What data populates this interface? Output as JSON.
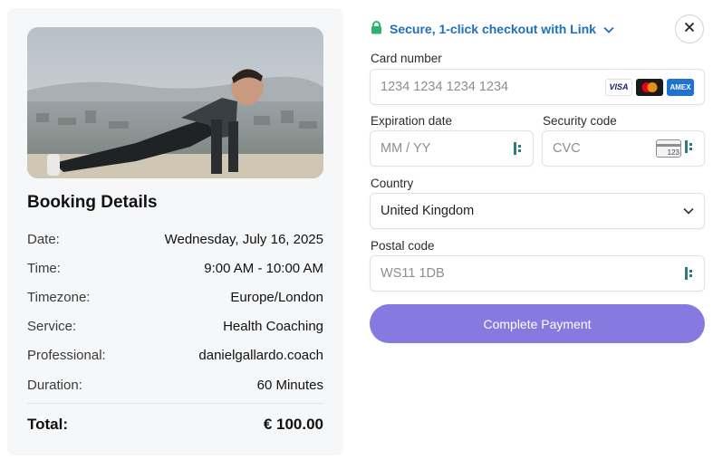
{
  "booking": {
    "title": "Booking Details",
    "rows": [
      {
        "key": "Date:",
        "value": "Wednesday, July 16, 2025"
      },
      {
        "key": "Time:",
        "value": "9:00 AM - 10:00 AM"
      },
      {
        "key": "Timezone:",
        "value": "Europe/London"
      },
      {
        "key": "Service:",
        "value": "Health Coaching"
      },
      {
        "key": "Professional:",
        "value": "danielgallardo.coach"
      },
      {
        "key": "Duration:",
        "value": "60 Minutes"
      }
    ],
    "total_label": "Total:",
    "total_value": "€ 100.00"
  },
  "checkout": {
    "link_text": "Secure, 1-click checkout with Link",
    "card_number_label": "Card number",
    "card_number_placeholder": "1234 1234 1234 1234",
    "card_brands": [
      "VISA",
      "Mastercard",
      "AMEX"
    ],
    "expiration_label": "Expiration date",
    "expiration_placeholder": "MM / YY",
    "security_label": "Security code",
    "security_placeholder": "CVC",
    "cvc_icon_text": "123",
    "country_label": "Country",
    "country_value": "United Kingdom",
    "postal_label": "Postal code",
    "postal_value": "WS11 1DB",
    "pay_button": "Complete Payment"
  },
  "colors": {
    "accent": "#8679e0",
    "link": "#1e6fbf",
    "lock": "#2fb36b"
  }
}
